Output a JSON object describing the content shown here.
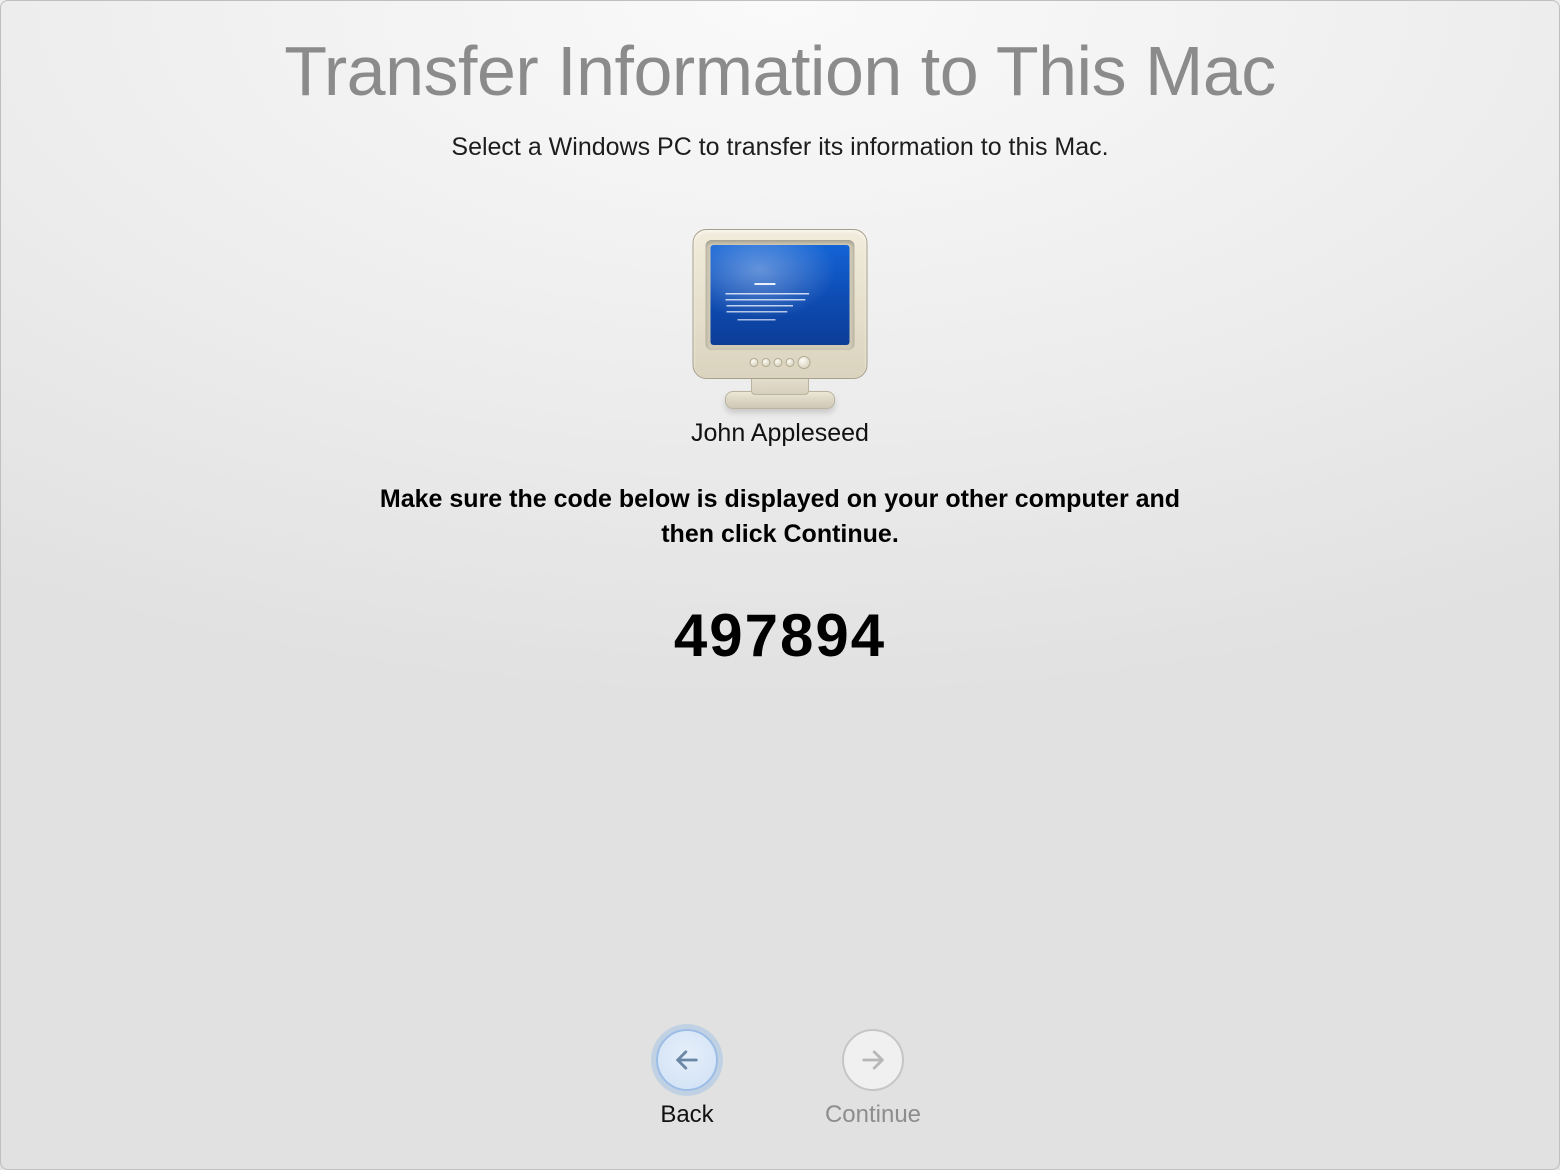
{
  "title": "Transfer Information to This Mac",
  "subtitle": "Select a Windows PC to transfer its information to this Mac.",
  "device": {
    "icon": "pc-crt-icon",
    "name": "John Appleseed"
  },
  "instruction": "Make sure the code below is displayed on your other computer and then click Continue.",
  "code": "497894",
  "nav": {
    "back_label": "Back",
    "continue_label": "Continue"
  }
}
